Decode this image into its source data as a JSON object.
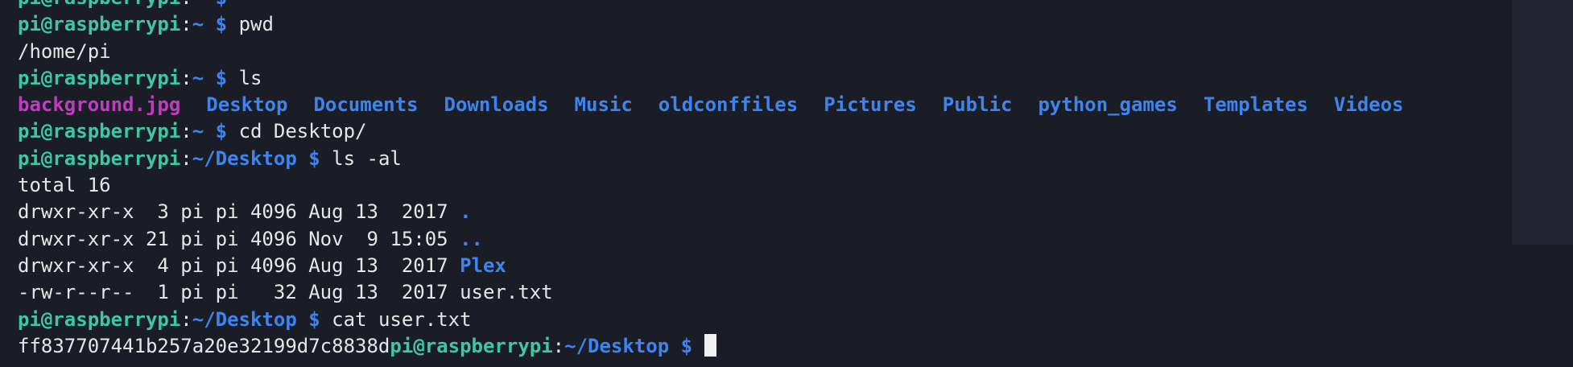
{
  "prompt": {
    "user_host": "pi@raspberrypi",
    "separator": ":",
    "dollar": "$"
  },
  "lines": [
    {
      "type": "prompt",
      "path": "~",
      "command": ""
    },
    {
      "type": "prompt",
      "path": "~",
      "command": "pwd"
    },
    {
      "type": "output",
      "text": "/home/pi"
    },
    {
      "type": "prompt",
      "path": "~",
      "command": "ls"
    },
    {
      "type": "ls",
      "items": [
        {
          "name": "background.jpg",
          "kind": "image"
        },
        {
          "name": "Desktop",
          "kind": "dir"
        },
        {
          "name": "Documents",
          "kind": "dir"
        },
        {
          "name": "Downloads",
          "kind": "dir"
        },
        {
          "name": "Music",
          "kind": "dir"
        },
        {
          "name": "oldconffiles",
          "kind": "dir"
        },
        {
          "name": "Pictures",
          "kind": "dir"
        },
        {
          "name": "Public",
          "kind": "dir"
        },
        {
          "name": "python_games",
          "kind": "dir"
        },
        {
          "name": "Templates",
          "kind": "dir"
        },
        {
          "name": "Videos",
          "kind": "dir"
        }
      ]
    },
    {
      "type": "prompt",
      "path": "~",
      "command": "cd Desktop/"
    },
    {
      "type": "prompt",
      "path": "~/Desktop",
      "command": "ls -al"
    },
    {
      "type": "output",
      "text": "total 16"
    },
    {
      "type": "listing",
      "meta": "drwxr-xr-x  3 pi pi 4096 Aug 13  2017 ",
      "name": ".",
      "kind": "dir"
    },
    {
      "type": "listing",
      "meta": "drwxr-xr-x 21 pi pi 4096 Nov  9 15:05 ",
      "name": "..",
      "kind": "dir"
    },
    {
      "type": "listing",
      "meta": "drwxr-xr-x  4 pi pi 4096 Aug 13  2017 ",
      "name": "Plex",
      "kind": "dir"
    },
    {
      "type": "listing",
      "meta": "-rw-r--r--  1 pi pi   32 Aug 13  2017 ",
      "name": "user.txt",
      "kind": "file"
    },
    {
      "type": "prompt",
      "path": "~/Desktop",
      "command": "cat user.txt"
    },
    {
      "type": "final",
      "output": "ff837707441b257a20e32199d7c8838d",
      "path": "~/Desktop"
    }
  ],
  "colors": {
    "background": "#1b1d26",
    "prompt_user": "#3dc9a0",
    "path_blue": "#3e84f0",
    "image_magenta": "#c23bc2",
    "text": "#e6e6e6"
  }
}
